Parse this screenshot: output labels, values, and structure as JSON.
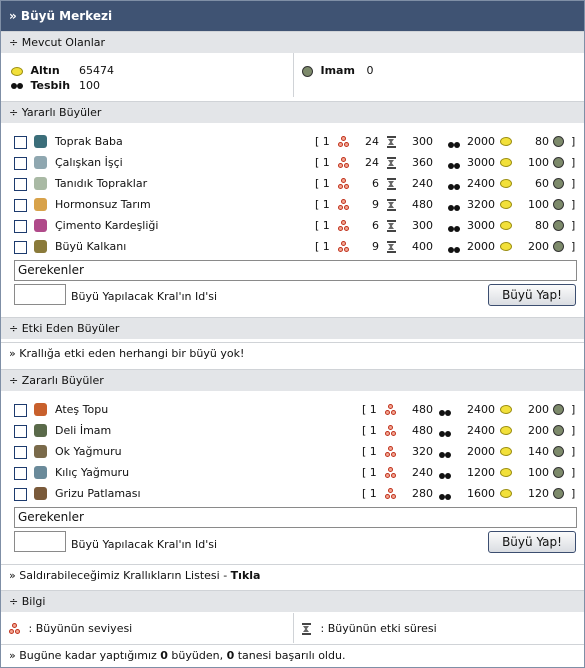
{
  "title": "» Büyü Merkezi",
  "sections": {
    "mevcut": "÷ Mevcut Olanlar",
    "yararli": "÷ Yararlı Büyüler",
    "etki": "÷ Etki Eden Büyüler",
    "zararli": "÷ Zararlı Büyüler",
    "bilgi": "÷ Bilgi"
  },
  "resources": {
    "altin_label": "Altın",
    "altin_value": "65474",
    "tesbih_label": "Tesbih",
    "tesbih_value": "100",
    "imam_label": "Imam",
    "imam_value": "0"
  },
  "beneficial": [
    {
      "name": "Toprak Baba",
      "open": "[ 1",
      "v1": "24",
      "v2": "300",
      "v3": "2000",
      "v4": "80",
      "close": "]",
      "icon_color": "#3b6e7a"
    },
    {
      "name": "Çalışkan İşçi",
      "open": "[ 1",
      "v1": "24",
      "v2": "360",
      "v3": "3000",
      "v4": "100",
      "close": "]",
      "icon_color": "#8fa7b0"
    },
    {
      "name": "Tanıdık Topraklar",
      "open": "[ 1",
      "v1": "6",
      "v2": "240",
      "v3": "2400",
      "v4": "60",
      "close": "]",
      "icon_color": "#a9b9a4"
    },
    {
      "name": "Hormonsuz Tarım",
      "open": "[ 1",
      "v1": "9",
      "v2": "480",
      "v3": "3200",
      "v4": "100",
      "close": "]",
      "icon_color": "#d8a24a"
    },
    {
      "name": "Çimento Kardeşliği",
      "open": "[ 1",
      "v1": "6",
      "v2": "300",
      "v3": "3000",
      "v4": "80",
      "close": "]",
      "icon_color": "#b04a8a"
    },
    {
      "name": "Büyü Kalkanı",
      "open": "[ 1",
      "v1": "9",
      "v2": "400",
      "v3": "2000",
      "v4": "200",
      "close": "]",
      "icon_color": "#8a7a3a"
    }
  ],
  "harmful": [
    {
      "name": "Ateş Topu",
      "open": "[ 1",
      "v1": "480",
      "v2": "2400",
      "v3": "200",
      "close": "]",
      "icon_color": "#c8602c"
    },
    {
      "name": "Deli İmam",
      "open": "[ 1",
      "v1": "480",
      "v2": "2400",
      "v3": "200",
      "close": "]",
      "icon_color": "#5a6a4a"
    },
    {
      "name": "Ok Yağmuru",
      "open": "[ 1",
      "v1": "320",
      "v2": "2000",
      "v3": "140",
      "close": "]",
      "icon_color": "#7a6a4a"
    },
    {
      "name": "Kılıç Yağmuru",
      "open": "[ 1",
      "v1": "240",
      "v2": "1200",
      "v3": "100",
      "close": "]",
      "icon_color": "#6a8a9a"
    },
    {
      "name": "Grizu Patlaması",
      "open": "[ 1",
      "v1": "280",
      "v2": "1600",
      "v3": "120",
      "close": "]",
      "icon_color": "#7a5a3a"
    }
  ],
  "form1": {
    "requirements": "Gerekenler",
    "id_label": "Büyü Yapılacak Kral'ın Id'si",
    "button": "Büyü Yap!"
  },
  "form2": {
    "requirements": "Gerekenler",
    "id_label": "Büyü Yapılacak Kral'ın Id'si",
    "button": "Büyü Yap!"
  },
  "etki_msg": "» Krallığa etki eden herhangi bir büyü yok!",
  "attack": {
    "text": "» Saldırabileceğimiz Krallıkların Listesi - ",
    "link": "Tıkla"
  },
  "legend": {
    "level": ": Büyünün seviyesi",
    "duration": ": Büyünün etki süresi"
  },
  "footer": {
    "prefix": "» Bugüne kadar yaptığımız ",
    "count1": "0",
    "middle": " büyüden, ",
    "count2": "0",
    "suffix": " tanesi başarılı oldu."
  }
}
